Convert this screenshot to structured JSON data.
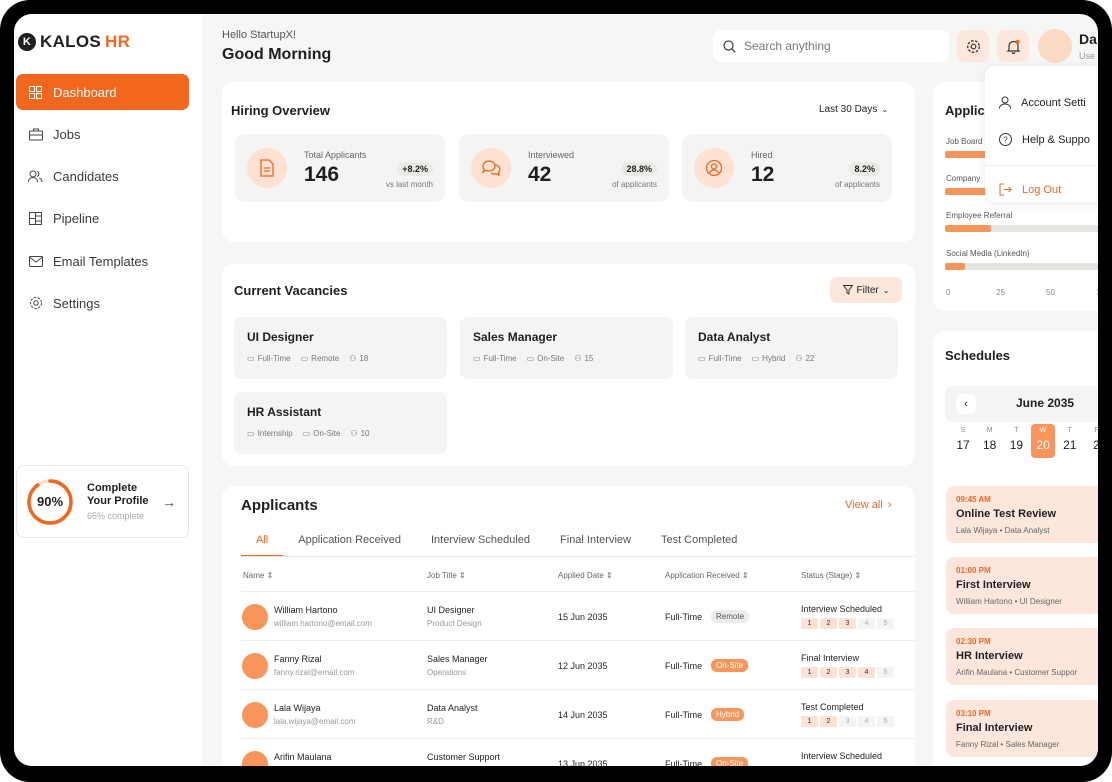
{
  "brand": {
    "part1": "KALOS",
    "part2": "HR"
  },
  "nav": [
    {
      "label": "Dashboard",
      "icon": "grid-icon"
    },
    {
      "label": "Jobs",
      "icon": "briefcase-icon"
    },
    {
      "label": "Candidates",
      "icon": "users-icon"
    },
    {
      "label": "Pipeline",
      "icon": "pipeline-icon"
    },
    {
      "label": "Email Templates",
      "icon": "mail-icon"
    },
    {
      "label": "Settings",
      "icon": "gear-icon"
    }
  ],
  "profile_card": {
    "percent_label": "90%",
    "progress": 0.9,
    "title": "Complete Your Profile",
    "subtitle": "65% complete"
  },
  "header": {
    "greeting": "Hello StartupX!",
    "title": "Good Morning",
    "search_placeholder": "Search anything",
    "user_name": "Da",
    "user_role": "Use"
  },
  "hiring": {
    "title": "Hiring Overview",
    "range": "Last 30 Days",
    "stats": [
      {
        "label": "Total Applicants",
        "value": "146",
        "badge": "+8.2%",
        "note": "vs last month",
        "icon": "document-icon"
      },
      {
        "label": "Interviewed",
        "value": "42",
        "badge": "28.8%",
        "note": "of applicants",
        "icon": "chat-icon"
      },
      {
        "label": "Hired",
        "value": "12",
        "badge": "8.2%",
        "note": "of applicants",
        "icon": "user-check-icon"
      }
    ]
  },
  "vacancies": {
    "title": "Current Vacancies",
    "filter": "Filter",
    "items": [
      {
        "title": "UI Designer",
        "type": "Full-Time",
        "mode": "Remote",
        "count": "18"
      },
      {
        "title": "Sales Manager",
        "type": "Full-Time",
        "mode": "On-Site",
        "count": "15"
      },
      {
        "title": "Data Analyst",
        "type": "Full-Time",
        "mode": "Hybrid",
        "count": "22"
      },
      {
        "title": "HR Assistant",
        "type": "Internship",
        "mode": "On-Site",
        "count": "10"
      }
    ]
  },
  "applicants": {
    "title": "Applicants",
    "view_all": "View all",
    "tabs": [
      "All",
      "Application Received",
      "Interview Scheduled",
      "Final Interview",
      "Test Completed"
    ],
    "columns": [
      "Name",
      "Job Title",
      "Applied Date",
      "Application Received",
      "Status (Stage)"
    ],
    "rows": [
      {
        "name": "William Hartono",
        "email": "william.hartono@email.com",
        "job": "UI Designer",
        "dept": "Product Design",
        "date": "15 Jun 2035",
        "type": "Full-Time",
        "mode": "Remote",
        "tag_style": "gray",
        "status": "Interview Scheduled",
        "stage": 3
      },
      {
        "name": "Fanny Rizal",
        "email": "fanny.rizal@email.com",
        "job": "Sales Manager",
        "dept": "Operations",
        "date": "12 Jun 2035",
        "type": "Full-Time",
        "mode": "On-Site",
        "tag_style": "orange",
        "status": "Final Interview",
        "stage": 4
      },
      {
        "name": "Lala Wijaya",
        "email": "lala.wijaya@email.com",
        "job": "Data Analyst",
        "dept": "R&D",
        "date": "14 Jun 2035",
        "type": "Full-Time",
        "mode": "Hybrid",
        "tag_style": "orange",
        "status": "Test Completed",
        "stage": 2
      },
      {
        "name": "Arifin Maulana",
        "email": "",
        "job": "Customer Support",
        "dept": "",
        "date": "13 Jun 2035",
        "type": "Full-Time",
        "mode": "On-Site",
        "tag_style": "orange",
        "status": "Interview Scheduled",
        "stage": 0
      }
    ],
    "step_labels": [
      "1",
      "2",
      "3",
      "4",
      "5"
    ]
  },
  "sources": {
    "title": "Applica",
    "items": [
      {
        "label": "Job Board",
        "value": 0.27
      },
      {
        "label": "Company",
        "value": 0.27
      },
      {
        "label": "Employee Referral",
        "value": 0.28
      },
      {
        "label": "Social Media (LinkedIn)",
        "value": 0.12
      }
    ],
    "axis": [
      "0",
      "25",
      "50",
      "75"
    ]
  },
  "schedules": {
    "title": "Schedules",
    "month": "June 2035",
    "days": [
      {
        "dn": "S",
        "dd": "17"
      },
      {
        "dn": "M",
        "dd": "18"
      },
      {
        "dn": "T",
        "dd": "19"
      },
      {
        "dn": "W",
        "dd": "20",
        "selected": true
      },
      {
        "dn": "T",
        "dd": "21"
      },
      {
        "dn": "F",
        "dd": "2"
      }
    ],
    "items": [
      {
        "time": "09:45 AM",
        "name": "Online Test Review",
        "detail": "Lala Wijaya • Data Analyst"
      },
      {
        "time": "01:00 PM",
        "name": "First Interview",
        "detail": "William Hartono • UI Designer"
      },
      {
        "time": "02:30 PM",
        "name": "HR Interview",
        "detail": "Arifin Maulana • Customer Suppor"
      },
      {
        "time": "03:10 PM",
        "name": "Final Interview",
        "detail": "Fanny Rizal • Sales Manager"
      }
    ]
  },
  "user_menu": {
    "account": "Account Setti",
    "help": "Help & Suppo",
    "logout": "Log Out"
  },
  "colors": {
    "accent": "#f2661e",
    "accent_light": "#fde7dc",
    "avatar": "#f7955a"
  }
}
